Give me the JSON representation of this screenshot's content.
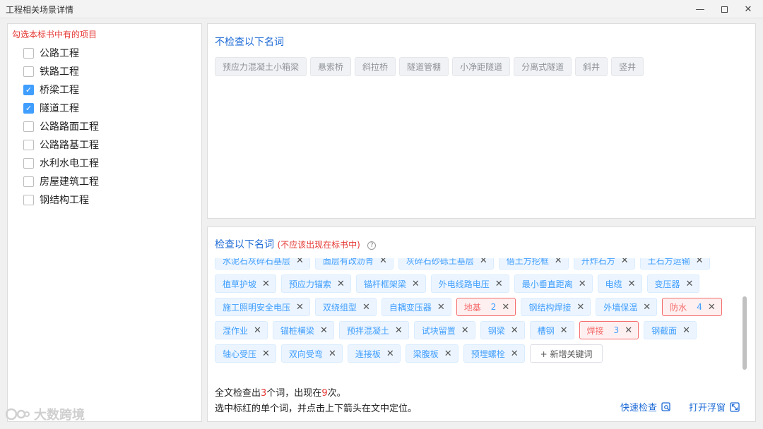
{
  "window": {
    "title": "工程相关场景详情",
    "controls": [
      "minimize",
      "maximize",
      "close"
    ]
  },
  "left": {
    "heading": "勾选本标书中有的项目",
    "items": [
      {
        "label": "公路工程",
        "checked": false
      },
      {
        "label": "铁路工程",
        "checked": false
      },
      {
        "label": "桥梁工程",
        "checked": true
      },
      {
        "label": "隧道工程",
        "checked": true
      },
      {
        "label": "公路路面工程",
        "checked": false
      },
      {
        "label": "公路路基工程",
        "checked": false
      },
      {
        "label": "水利水电工程",
        "checked": false
      },
      {
        "label": "房屋建筑工程",
        "checked": false
      },
      {
        "label": "钢结构工程",
        "checked": false
      }
    ]
  },
  "no_check": {
    "title": "不检查以下名词",
    "tags": [
      "预应力混凝土小箱梁",
      "悬索桥",
      "斜拉桥",
      "隧道管棚",
      "小净距隧道",
      "分离式隧道",
      "斜井",
      "竖井"
    ]
  },
  "check": {
    "title": "检查以下名词",
    "warning": "(不应该出现在标书中)",
    "help_icon": "question-circle-icon",
    "rows": [
      [
        {
          "label": "水泥石灰碎石基层"
        },
        {
          "label": "面层有改沥青"
        },
        {
          "label": "灰碎石砂砾土基层"
        },
        {
          "label": "借土方挖框"
        },
        {
          "label": "开炸石方"
        },
        {
          "label": "土石方运输"
        }
      ],
      [
        {
          "label": "植草护坡"
        },
        {
          "label": "预应力锚索"
        },
        {
          "label": "锚杆框架梁"
        },
        {
          "label": "外电线路电压"
        },
        {
          "label": "最小垂直距离"
        },
        {
          "label": "电缆"
        },
        {
          "label": "变压器"
        }
      ],
      [
        {
          "label": "施工照明安全电压"
        },
        {
          "label": "双绕组型"
        },
        {
          "label": "自耦变压器"
        },
        {
          "label": "地基",
          "count": "2",
          "hit": true
        },
        {
          "label": "钢结构焊接"
        },
        {
          "label": "外墙保温"
        },
        {
          "label": "防水",
          "count": "4",
          "hit": true
        }
      ],
      [
        {
          "label": "湿作业"
        },
        {
          "label": "锚桩横梁"
        },
        {
          "label": "预拌混凝土"
        },
        {
          "label": "试块留置"
        },
        {
          "label": "钢梁"
        },
        {
          "label": "槽钢"
        },
        {
          "label": "焊接",
          "count": "3",
          "hit": true
        },
        {
          "label": "钢截面"
        }
      ],
      [
        {
          "label": "轴心受压"
        },
        {
          "label": "双向受弯"
        },
        {
          "label": "连接板"
        },
        {
          "label": "梁腹板"
        },
        {
          "label": "预埋螺栓"
        }
      ]
    ],
    "add_label": "+ 新增关键词"
  },
  "summary": {
    "line1_a": "全文检查出",
    "word_count": "3",
    "line1_b": "个词，出现在",
    "occurrences": "9",
    "line1_c": "次。",
    "line2": "选中标红的单个词，并点击上下箭头在文中定位。"
  },
  "actions": {
    "quick_check": "快速检查",
    "float_window": "打开浮窗"
  },
  "watermark": "大数跨境",
  "colors": {
    "accent": "#409eff",
    "title_blue": "#1e6bd6",
    "warn_red": "#e53935"
  }
}
